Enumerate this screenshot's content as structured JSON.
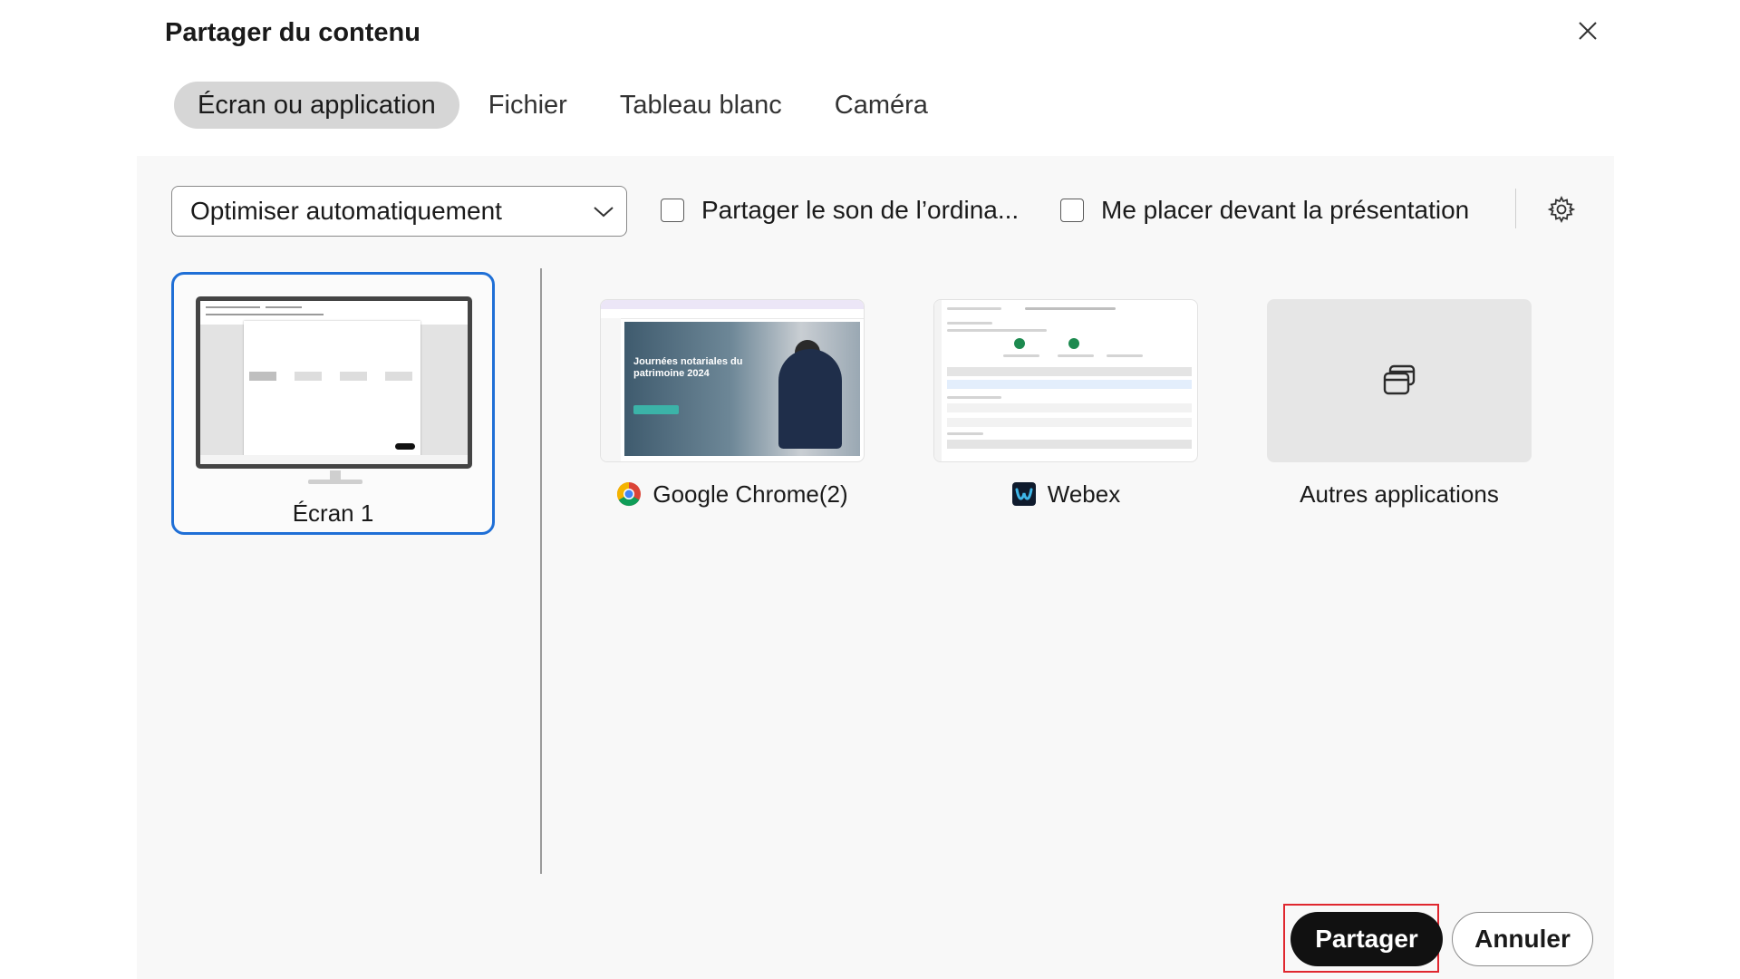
{
  "dialog": {
    "title": "Partager du contenu",
    "close_icon": "close-icon"
  },
  "tabs": [
    {
      "label": "Écran ou application",
      "active": true
    },
    {
      "label": "Fichier",
      "active": false
    },
    {
      "label": "Tableau blanc",
      "active": false
    },
    {
      "label": "Caméra",
      "active": false
    }
  ],
  "toolbar": {
    "optimize_select": {
      "value": "Optimiser automatiquement"
    },
    "share_sound": {
      "label": "Partager le son de l’ordina...",
      "checked": false
    },
    "place_in_front": {
      "label": "Me placer devant la présentation",
      "checked": false
    },
    "settings_icon": "gear-icon"
  },
  "sources": {
    "screen": {
      "label": "Écran 1",
      "selected": true
    },
    "apps": [
      {
        "label": "Google Chrome(2)",
        "icon": "chrome-icon"
      },
      {
        "label": "Webex",
        "icon": "webex-icon"
      },
      {
        "label": "Autres applications",
        "icon": "windows-stack-icon"
      }
    ],
    "chrome_preview_title": "Journées notariales du patrimoine 2024"
  },
  "footer": {
    "share_label": "Partager",
    "cancel_label": "Annuler"
  },
  "colors": {
    "accent_selected": "#1f6fd6",
    "primary_button": "#111111",
    "highlight_outline": "#e0272f"
  }
}
